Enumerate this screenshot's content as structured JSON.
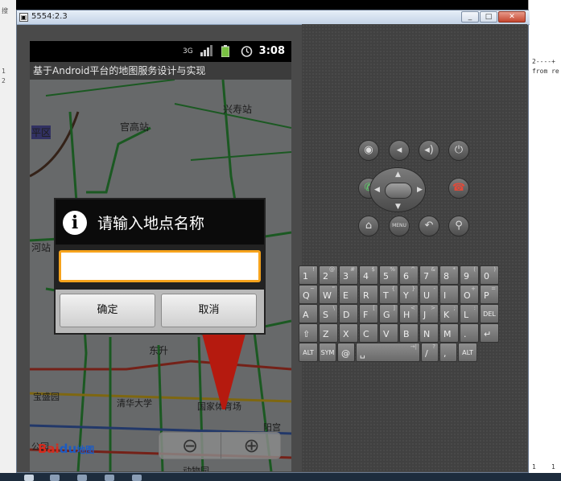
{
  "window": {
    "title": "5554:2.3",
    "icon": "emulator-icon",
    "minimize_label": "_",
    "maximize_label": "□",
    "close_label": "✕"
  },
  "background": {
    "left_snippets": [
      "搜",
      "1",
      "2"
    ],
    "right_code": [
      "2----+",
      "from re"
    ],
    "right_bottom": [
      "1",
      "1"
    ]
  },
  "status_bar": {
    "network": "3G",
    "signal_icon": "signal-bars-icon",
    "battery_icon": "battery-icon",
    "alarm_icon": "alarm-clock-icon",
    "time": "3:08"
  },
  "app": {
    "title": "基于Android平台的地图服务设计与实现"
  },
  "map": {
    "labels": [
      "兴寿站",
      "官高站",
      "平区",
      "河站",
      "东升",
      "宝盛园",
      "清华大学",
      "国家体育场",
      "阳宫",
      "公园",
      "动物园"
    ],
    "logo": {
      "bai": "Bai",
      "du": "du",
      "cn": "地图"
    },
    "zoom_out_icon": "zoom-out-icon",
    "zoom_in_icon": "zoom-in-icon",
    "pin_color": "#b51a0f"
  },
  "dialog": {
    "icon": "info-icon",
    "title": "请输入地点名称",
    "input_value": "",
    "ok_label": "确定",
    "cancel_label": "取消",
    "accent": "#f6a31c"
  },
  "controls": {
    "row1": [
      "camera-icon",
      "volume-down-icon",
      "volume-up-icon",
      "power-icon"
    ],
    "row2_left": "call-icon",
    "row2_right": "end-call-icon",
    "row3": [
      "home-icon",
      "menu-icon",
      "back-icon",
      "search-icon"
    ],
    "menu_label": "MENU"
  },
  "keyboard": {
    "row1": [
      [
        "1",
        "!"
      ],
      [
        "2",
        "@"
      ],
      [
        "3",
        "#"
      ],
      [
        "4",
        "$"
      ],
      [
        "5",
        "%"
      ],
      [
        "6",
        "^"
      ],
      [
        "7",
        "&"
      ],
      [
        "8",
        "*"
      ],
      [
        "9",
        "("
      ],
      [
        "0",
        ")"
      ]
    ],
    "row2": [
      [
        "Q",
        "~"
      ],
      [
        "W",
        "\""
      ],
      [
        "E",
        ""
      ],
      [
        "R",
        ""
      ],
      [
        "T",
        "{"
      ],
      [
        "Y",
        "}"
      ],
      [
        "U",
        "-"
      ],
      [
        "I",
        ""
      ],
      [
        "O",
        "+"
      ],
      [
        "P",
        "="
      ]
    ],
    "row3": [
      [
        "A",
        ""
      ],
      [
        "S",
        "\\"
      ],
      [
        "D",
        ""
      ],
      [
        "F",
        "["
      ],
      [
        "G",
        "]"
      ],
      [
        "H",
        "<"
      ],
      [
        "J",
        ">"
      ],
      [
        "K",
        ";"
      ],
      [
        "L",
        ":"
      ],
      [
        "DEL",
        ""
      ]
    ],
    "row4": [
      [
        "⇧",
        ""
      ],
      [
        "Z",
        ""
      ],
      [
        "X",
        ""
      ],
      [
        "C",
        ""
      ],
      [
        "V",
        ""
      ],
      [
        "B",
        ""
      ],
      [
        "N",
        ""
      ],
      [
        "M",
        ""
      ],
      [
        ".",
        ""
      ],
      [
        "↵",
        ""
      ]
    ],
    "row5": [
      [
        "ALT",
        ""
      ],
      [
        "SYM",
        ""
      ],
      [
        "@",
        ""
      ],
      [
        "␣",
        "→|"
      ],
      [
        "/",
        "?"
      ],
      [
        ",",
        ""
      ],
      [
        "ALT",
        ""
      ]
    ]
  }
}
